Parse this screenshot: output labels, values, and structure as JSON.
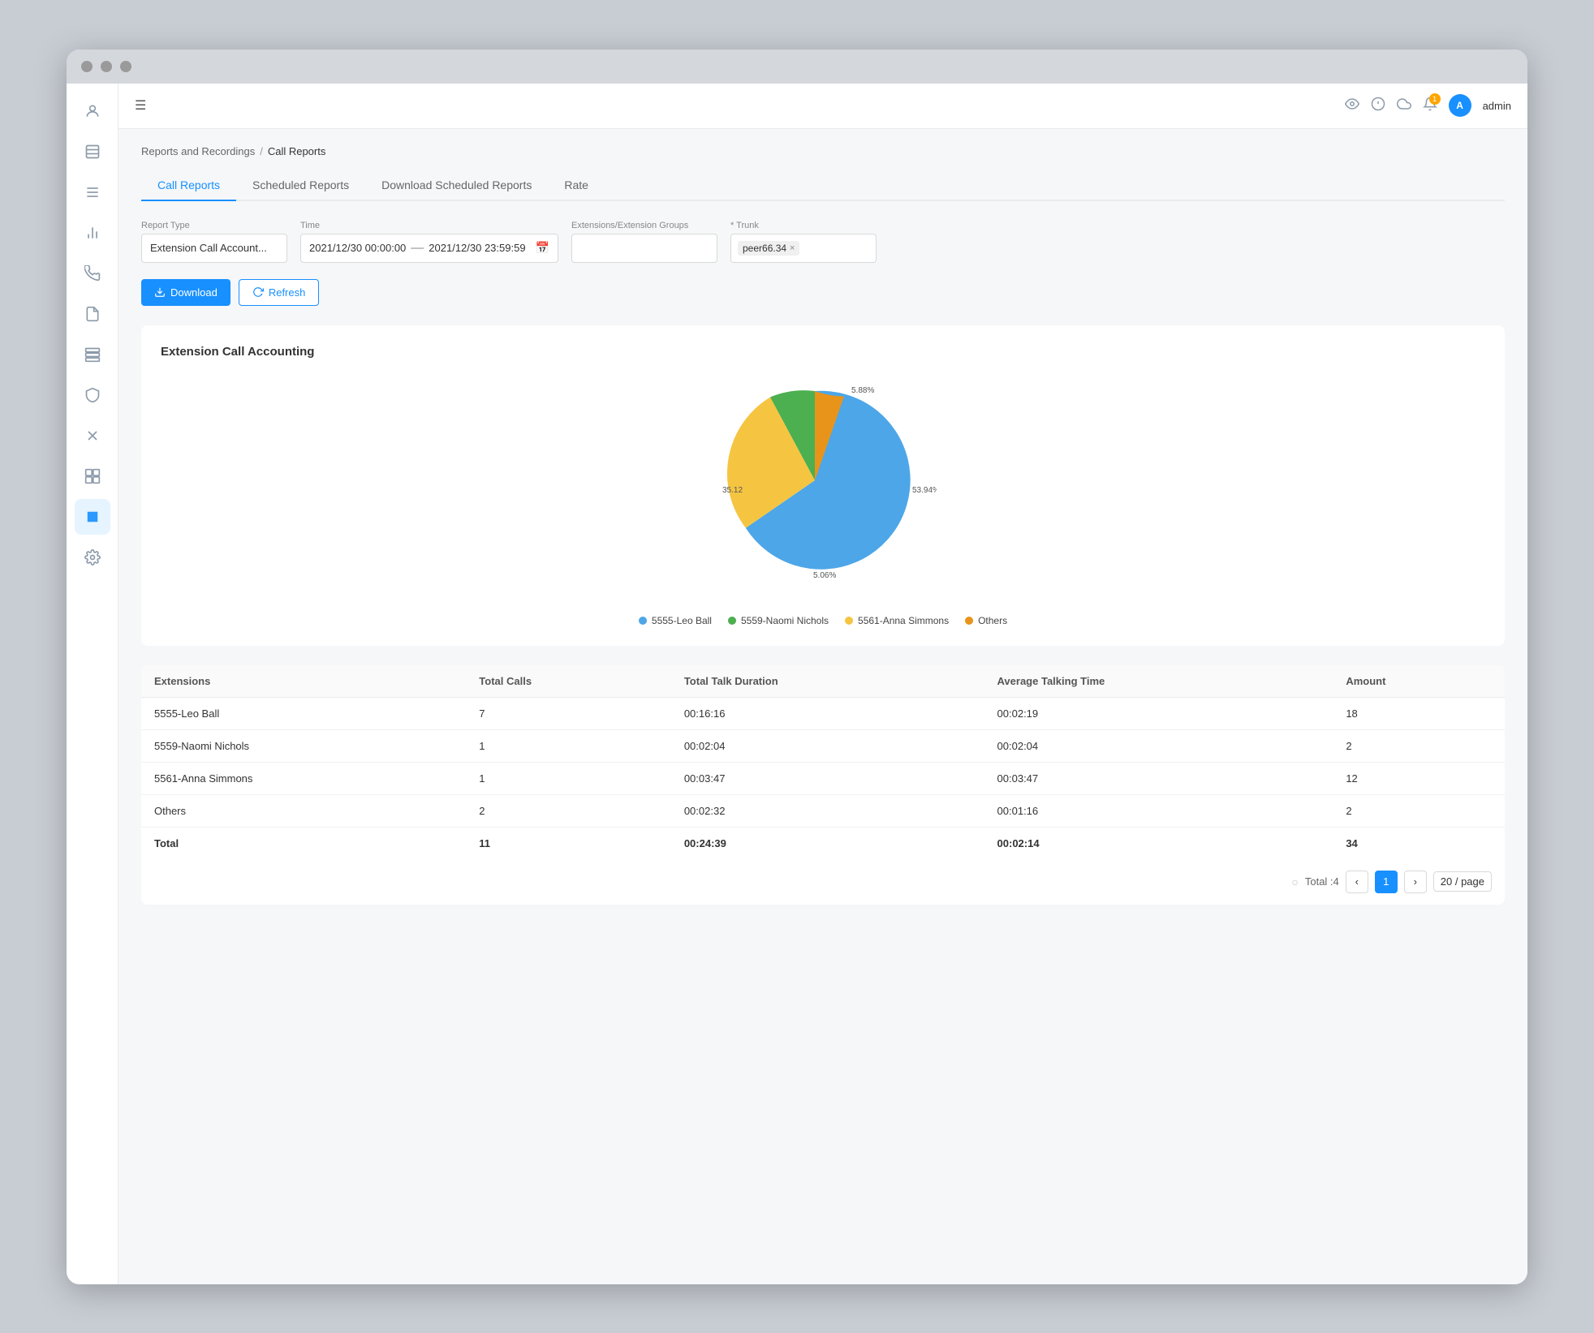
{
  "browser": {
    "traffic_lights": [
      "close",
      "minimize",
      "maximize"
    ]
  },
  "sidebar": {
    "items": [
      {
        "id": "user",
        "icon": "👤",
        "active": false
      },
      {
        "id": "dashboard",
        "icon": "⊞",
        "active": false
      },
      {
        "id": "list",
        "icon": "☰",
        "active": false
      },
      {
        "id": "chart",
        "icon": "⧫",
        "active": false
      },
      {
        "id": "phone",
        "icon": "☎",
        "active": false
      },
      {
        "id": "document",
        "icon": "📄",
        "active": false
      },
      {
        "id": "server",
        "icon": "▣",
        "active": false
      },
      {
        "id": "shield",
        "icon": "⊙",
        "active": false
      },
      {
        "id": "tools",
        "icon": "✕",
        "active": false
      },
      {
        "id": "plugin",
        "icon": "⊕",
        "active": false
      },
      {
        "id": "reports",
        "icon": "📊",
        "active": true
      },
      {
        "id": "settings",
        "icon": "⚙",
        "active": false
      }
    ]
  },
  "topbar": {
    "menu_icon": "☰",
    "icons": [
      "👁",
      "ⓘ",
      "☁"
    ],
    "notification_count": "1",
    "admin_label": "admin"
  },
  "breadcrumb": {
    "parent": "Reports and Recordings",
    "separator": "/",
    "current": "Call Reports"
  },
  "tabs": [
    {
      "id": "call-reports",
      "label": "Call Reports",
      "active": true
    },
    {
      "id": "scheduled-reports",
      "label": "Scheduled Reports",
      "active": false
    },
    {
      "id": "download-scheduled-reports",
      "label": "Download Scheduled Reports",
      "active": false
    },
    {
      "id": "rate",
      "label": "Rate",
      "active": false
    }
  ],
  "filters": {
    "report_type_label": "Report Type",
    "report_type_value": "Extension Call Account...",
    "time_label": "Time",
    "date_start": "2021/12/30 00:00:00",
    "date_end": "2021/12/30 23:59:59",
    "extensions_label": "Extensions/Extension Groups",
    "trunk_label": "* Trunk",
    "trunk_tag": "peer66.34",
    "trunk_close": "×"
  },
  "actions": {
    "download_label": "Download",
    "refresh_label": "Refresh"
  },
  "chart": {
    "title": "Extension Call Accounting",
    "segments": [
      {
        "label": "5555-Leo Ball",
        "color": "#4da6e8",
        "percentage": 53.94,
        "angle": 194
      },
      {
        "label": "5561-Anna Simmons",
        "color": "#f5c542",
        "percentage": 35.12,
        "angle": 126
      },
      {
        "label": "Others",
        "color": "#e8a020",
        "percentage": 5.88,
        "angle": 21
      },
      {
        "label": "5559-Naomi Nichols",
        "color": "#4caf50",
        "percentage": 5.06,
        "angle": 18
      }
    ],
    "labels_on_chart": [
      {
        "text": "5.88%",
        "x": "52%",
        "y": "8%"
      },
      {
        "text": "35.12",
        "x": "30%",
        "y": "44%"
      },
      {
        "text": "53.94%",
        "x": "80%",
        "y": "48%"
      },
      {
        "text": "5.06%",
        "x": "52%",
        "y": "86%"
      }
    ],
    "legend": [
      {
        "label": "5555-Leo Ball",
        "color": "#4da6e8"
      },
      {
        "label": "5559-Naomi Nichols",
        "color": "#4caf50"
      },
      {
        "label": "5561-Anna Simmons",
        "color": "#f5c542"
      },
      {
        "label": "Others",
        "color": "#e8a020"
      }
    ]
  },
  "table": {
    "columns": [
      "Extensions",
      "Total Calls",
      "Total Talk Duration",
      "Average Talking Time",
      "Amount"
    ],
    "rows": [
      {
        "extension": "5555-Leo Ball",
        "total_calls": "7",
        "talk_duration": "00:16:16",
        "avg_time": "00:02:19",
        "amount": "18"
      },
      {
        "extension": "5559-Naomi Nichols",
        "total_calls": "1",
        "talk_duration": "00:02:04",
        "avg_time": "00:02:04",
        "amount": "2"
      },
      {
        "extension": "5561-Anna Simmons",
        "total_calls": "1",
        "talk_duration": "00:03:47",
        "avg_time": "00:03:47",
        "amount": "12"
      },
      {
        "extension": "Others",
        "total_calls": "2",
        "talk_duration": "00:02:32",
        "avg_time": "00:01:16",
        "amount": "2"
      }
    ],
    "total_row": {
      "label": "Total",
      "total_calls": "11",
      "talk_duration": "00:24:39",
      "avg_time": "00:02:14",
      "amount": "34"
    }
  },
  "pagination": {
    "total_label": "Total :4",
    "current_page": "1",
    "page_size": "20 / page"
  }
}
